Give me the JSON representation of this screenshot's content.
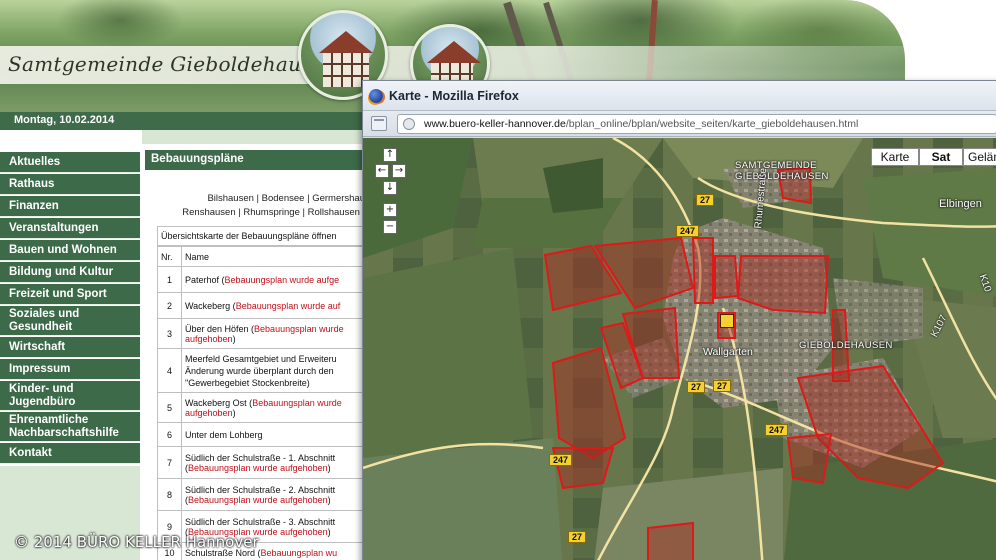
{
  "site": {
    "title": "Samtgemeinde Gieboldehausen",
    "date": "Montag, 10.02.2014",
    "nav": [
      "Aktuelles",
      "Rathaus",
      "Finanzen",
      "Veranstaltungen",
      "Bauen und Wohnen",
      "Bildung und Kultur",
      "Freizeit und Sport",
      "Soziales und Gesundheit",
      "Wirtschaft",
      "Impressum",
      "Kinder- und Jugendbüro",
      "Ehrenamtliche Nachbarschaftshilfe",
      "Kontakt"
    ],
    "section_title": "Bebauungspläne",
    "places_line1": "Bilshausen | Bodensee | Germershau",
    "places_line2": "Renshausen | Rhumspringe | Rollshausen |",
    "overview_text": "Übersichtskarte der Bebauungspläne öffnen",
    "table_header": {
      "nr": "Nr.",
      "name": "Name"
    },
    "rows": [
      {
        "nr": "1",
        "line1": "Paterhof (",
        "red1": "Bebauungsplan wurde aufge",
        "line2": "",
        "red2": ""
      },
      {
        "nr": "2",
        "line1": "Wackeberg (",
        "red1": "Bebauungsplan wurde auf",
        "line2": "",
        "red2": ""
      },
      {
        "nr": "3",
        "line1": "Über den Höfen (",
        "red1": "Bebauungsplan wurde",
        "line2": "",
        "red2": "aufgehoben",
        "tail2": ")"
      },
      {
        "nr": "4",
        "line1": "Meerfeld Gesamtgebiet und Erweiteru",
        "red1": "",
        "line2": "Änderung wurde überplant durch den",
        "red2": "",
        "line3": "\"Gewerbegebiet Stockenbreite)"
      },
      {
        "nr": "5",
        "line1": "Wackeberg Ost (",
        "red1": "Bebauungsplan wurde",
        "line2": "",
        "red2": "aufgehoben",
        "tail2": ")"
      },
      {
        "nr": "6",
        "line1": "Unter dem Lohberg",
        "red1": "",
        "line2": "",
        "red2": ""
      },
      {
        "nr": "7",
        "line1": "Südlich der Schulstraße - 1. Abschnitt",
        "red1": "",
        "line2": "(",
        "red2": "Bebauungsplan wurde aufgehoben",
        "tail2": ")"
      },
      {
        "nr": "8",
        "line1": "Südlich der Schulstraße - 2. Abschnitt",
        "red1": "",
        "line2": "(",
        "red2": "Bebauungsplan wurde aufgehoben",
        "tail2": ")"
      },
      {
        "nr": "9",
        "line1": "Südlich der Schulstraße - 3. Abschnitt",
        "red1": "",
        "line2": "(",
        "red2": "Bebauungsplan wurde aufgehoben",
        "tail2": ")"
      },
      {
        "nr": "10",
        "line1": "Schulstraße Nord (",
        "red1": "Bebauungsplan wu",
        "line2": "",
        "red2": ""
      }
    ],
    "copyright": "© 2014 BÜRO KELLER Hannover"
  },
  "browser": {
    "window_title": "Karte - Mozilla Firefox",
    "url_host": "www.buero-keller-hannover.de",
    "url_path": "/bplan_online/bplan/website_seiten/karte_gieboldehausen.html",
    "map": {
      "types": [
        "Karte",
        "Sat",
        "Gelän"
      ],
      "active_type": "Sat",
      "controls": {
        "up": "↑",
        "left": "←",
        "right": "→",
        "down": "↓",
        "zoom_in": "+",
        "zoom_out": "−"
      },
      "labels": {
        "samtgemeinde": "SAMTGEMEINDE",
        "gieboldehausen_top": "GIEBOLDEHAUSEN",
        "elbingen": "Elbingen",
        "rhumestrasse": "Rhumestraße",
        "gieboldehausen_center": "GIEBOLDEHAUSEN",
        "wallgarten": "Wallgarten",
        "k107": "K107",
        "k10": "K10"
      },
      "shields": [
        "27",
        "247",
        "27",
        "247",
        "27",
        "247",
        "27"
      ],
      "accent_red": "#e01818"
    }
  }
}
